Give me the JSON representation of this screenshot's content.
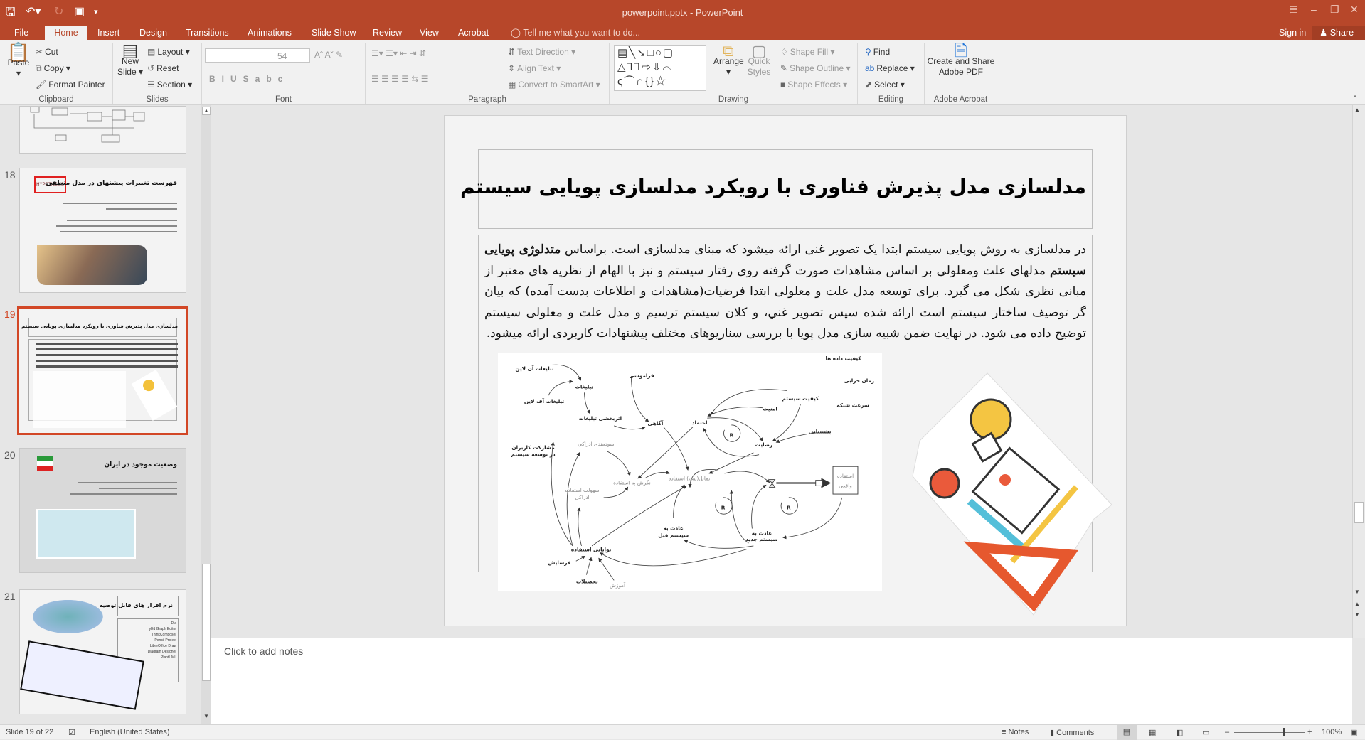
{
  "window": {
    "title": "powerpoint.pptx - PowerPoint",
    "accent": "#b7472a"
  },
  "qat": {
    "save": "save-icon",
    "undo": "undo-icon",
    "redo": "redo-icon",
    "present": "start-from-beginning-icon"
  },
  "tabs": [
    "File",
    "Home",
    "Insert",
    "Design",
    "Transitions",
    "Animations",
    "Slide Show",
    "Review",
    "View",
    "Acrobat"
  ],
  "active_tab": "Home",
  "tell_me": "Tell me what you want to do...",
  "account": {
    "sign_in": "Sign in",
    "share": "Share"
  },
  "ribbon": {
    "clipboard": {
      "label": "Clipboard",
      "paste": "Paste",
      "cut": "Cut",
      "copy": "Copy",
      "format_painter": "Format Painter"
    },
    "slides": {
      "label": "Slides",
      "new_slide": "New Slide",
      "layout": "Layout",
      "reset": "Reset",
      "section": "Section"
    },
    "font": {
      "label": "Font",
      "font_name": "",
      "font_size": "54"
    },
    "paragraph": {
      "label": "Paragraph",
      "text_direction": "Text Direction",
      "align_text": "Align Text",
      "convert_smartart": "Convert to SmartArt"
    },
    "drawing": {
      "label": "Drawing",
      "arrange": "Arrange",
      "quick_styles": "Quick Styles",
      "shape_fill": "Shape Fill",
      "shape_outline": "Shape Outline",
      "shape_effects": "Shape Effects"
    },
    "editing": {
      "label": "Editing",
      "find": "Find",
      "replace": "Replace",
      "select": "Select"
    },
    "acrobat": {
      "label": "Adobe Acrobat",
      "create_share": "Create and Share Adobe PDF"
    }
  },
  "thumbnails": [
    {
      "number": "",
      "title": ""
    },
    {
      "number": "18",
      "title": "فهرست تغییرات پیشنهای در مدل منطقی",
      "badge": "HYPOTHESIS"
    },
    {
      "number": "19",
      "title": "مدلسازی مدل پذیرش فناوری با رویکرد مدلسازی پویایی سیستم",
      "selected": true
    },
    {
      "number": "20",
      "title": "وضعیت موجود در ایران"
    },
    {
      "number": "21",
      "title": "نرم افزار های قابل توصیه",
      "items": [
        "Dia",
        "yEd Graph Editor",
        "ThinkComposer",
        "Pencil Project",
        "LibreOffice Draw",
        "Diagram Designer",
        "PlantUML"
      ]
    }
  ],
  "slide": {
    "title": "مدلسازی مدل پذیرش فناوری با رویکرد مدلسازی پویایی سیستم",
    "body_parts": [
      "در مدلسازی به روش پویایی سیستم ابتدا یک تصویر غنی ارائه میشود که مبنای مدلسازی است. براساس ",
      "متدلوژی پویایی سیستم",
      " مدلهای علت ومعلولی بر اساس مشاهدات صورت گرفته روی رفتار سیستم و نیز با الهام از نظریه های معتبر از مبانی نظری شکل می گیرد. برای توسعه مدل علت و معلولی ابتدا فرضیات(مشاهدات و اطلاعات بدست آمده) که بیان گر توصیف ساختار سیستم است ارائه شده سپس تصویر غني، و کلان سیستم ترسیم و مدل علت و معلولی سیستم توضیح داده می شود. در نهایت ضمن شبیه سازی مدل پویا با بررسی سناریوهای مختلف پیشنهادات کاربردی ارائه میشود."
    ],
    "diagram_labels": {
      "online_ads": "تبلیغات آن لاین",
      "ads": "تبلیغات",
      "offline_ads": "تبلیغات آف لاین",
      "ad_effect": "اثربخشی تبلیغات",
      "forgetting": "فراموشی",
      "awareness": "آگاهی",
      "trust": "اعتماد",
      "security": "امنیت",
      "system_quality": "کیفیت سیستم",
      "data_quality": "کیفیت داده ها",
      "downtime": "زمان خرابی",
      "network_speed": "سرعت شبکه",
      "support": "پشتیبانی",
      "satisfaction": "رضایت",
      "usefulness": "سودمندی ادراکی",
      "participation_1": "مشارکت کاربران",
      "participation_2": "در توسعه سیستم",
      "attitude": "نگرش به استفاده",
      "intention": "تمایل(نیت) استفاده",
      "ease_1": "سهولت استفاده",
      "ease_2": "ادراکی",
      "actual_use_1": "استفاده",
      "actual_use_2": "واقعی",
      "old_habit_1": "عادت به",
      "old_habit_2": "سیستم قبل",
      "new_habit_1": "عادت به",
      "new_habit_2": "سیستم جدید",
      "ability": "توانایی استفاده",
      "attrition": "فرسایش",
      "education": "تحصیلات",
      "training": "آموزش",
      "loop": "R"
    }
  },
  "notes_placeholder": "Click to add notes",
  "status": {
    "slide": "Slide 19 of 22",
    "language": "English (United States)",
    "notes": "Notes",
    "comments": "Comments",
    "zoom": "100%",
    "zoom_percent": 100
  }
}
